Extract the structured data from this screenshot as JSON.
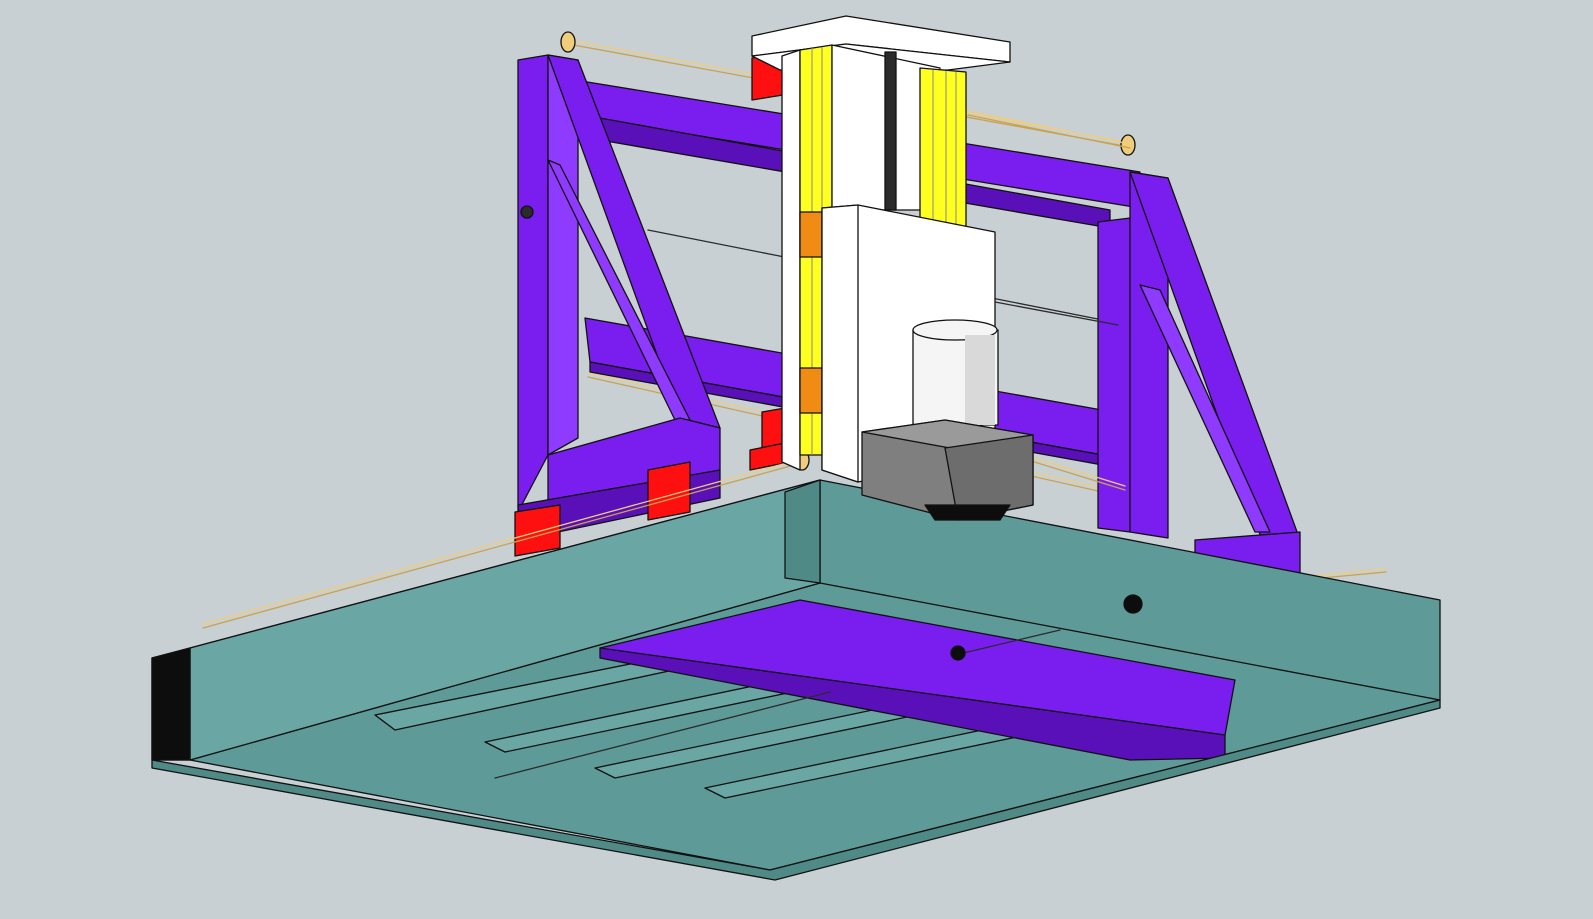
{
  "scene": {
    "background": "#c8d0d3",
    "colors": {
      "frame_purple": "#7a1ef0",
      "frame_purple_light": "#8f3bff",
      "frame_purple_dark": "#5a10b8",
      "table_teal_top": "#5e9b98",
      "table_teal_side": "#4f8a87",
      "table_teal_light": "#6aa7a4",
      "table_shadow": "#0d0d0d",
      "rail_gold": "#f0cd7a",
      "rail_gold_dark": "#c9a24f",
      "bearing_red": "#ff1010",
      "block_orange": "#f08c14",
      "slide_yellow": "#ffff20",
      "plate_white": "#ffffff",
      "screw_black": "#2b2b2b",
      "motor_grey": "#7f7f7f",
      "spindle_white": "#f5f5f5"
    }
  }
}
